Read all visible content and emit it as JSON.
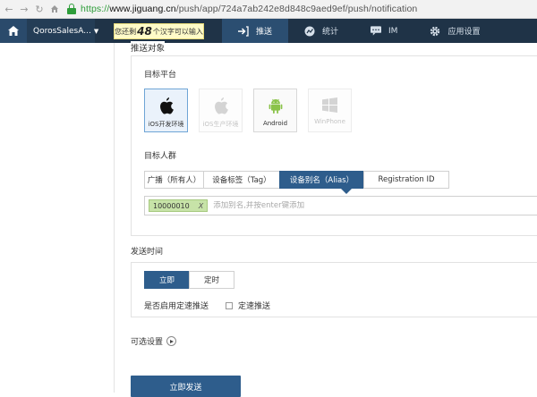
{
  "browser": {
    "url_scheme": "https://",
    "url_host": "www.jiguang.cn",
    "url_path": "/push/app/724a7ab242e8d848c9aed9ef/push/notification"
  },
  "topnav": {
    "app_name": "QorosSalesA...",
    "tip_prefix": "您还剩",
    "tip_count": "48",
    "tip_suffix": "个汉字可以输入",
    "items": [
      {
        "label": "推送",
        "icon": "send-icon"
      },
      {
        "label": "统计",
        "icon": "chart-icon"
      },
      {
        "label": "IM",
        "icon": "chat-icon"
      },
      {
        "label": "应用设置",
        "icon": "gear-icon"
      }
    ],
    "active_index": 0
  },
  "target": {
    "section_title": "推送对象",
    "platform_label": "目标平台",
    "platforms": [
      {
        "label": "iOS开发环境",
        "icon": "apple-icon",
        "state": "selected"
      },
      {
        "label": "iOS生产环境",
        "icon": "apple-icon",
        "state": "disabled"
      },
      {
        "label": "Android",
        "icon": "android-icon",
        "state": "normal"
      },
      {
        "label": "WinPhone",
        "icon": "windows-icon",
        "state": "disabled"
      }
    ],
    "audience_label": "目标人群",
    "tabs": [
      "广播（所有人）",
      "设备标签（Tag）",
      "设备别名（Alias）",
      "Registration ID"
    ],
    "active_tab": 2,
    "alias_tag": "10000010",
    "alias_tag_remove": "X",
    "alias_placeholder": "添加别名,并按enter键添加"
  },
  "send_time": {
    "label": "发送时间",
    "options": [
      "立即",
      "定时"
    ],
    "active_option": 0,
    "rate_question": "是否启用定速推送",
    "rate_checkbox_label": "定速推送"
  },
  "optional_label": "可选设置",
  "submit_label": "立即发送",
  "colors": {
    "nav_bg": "#1f3347",
    "primary": "#2e5d8c",
    "tip_bg": "#fffbc8",
    "alias_tag_bg": "#c7e3a8",
    "secure_green": "#2e9d3a"
  }
}
